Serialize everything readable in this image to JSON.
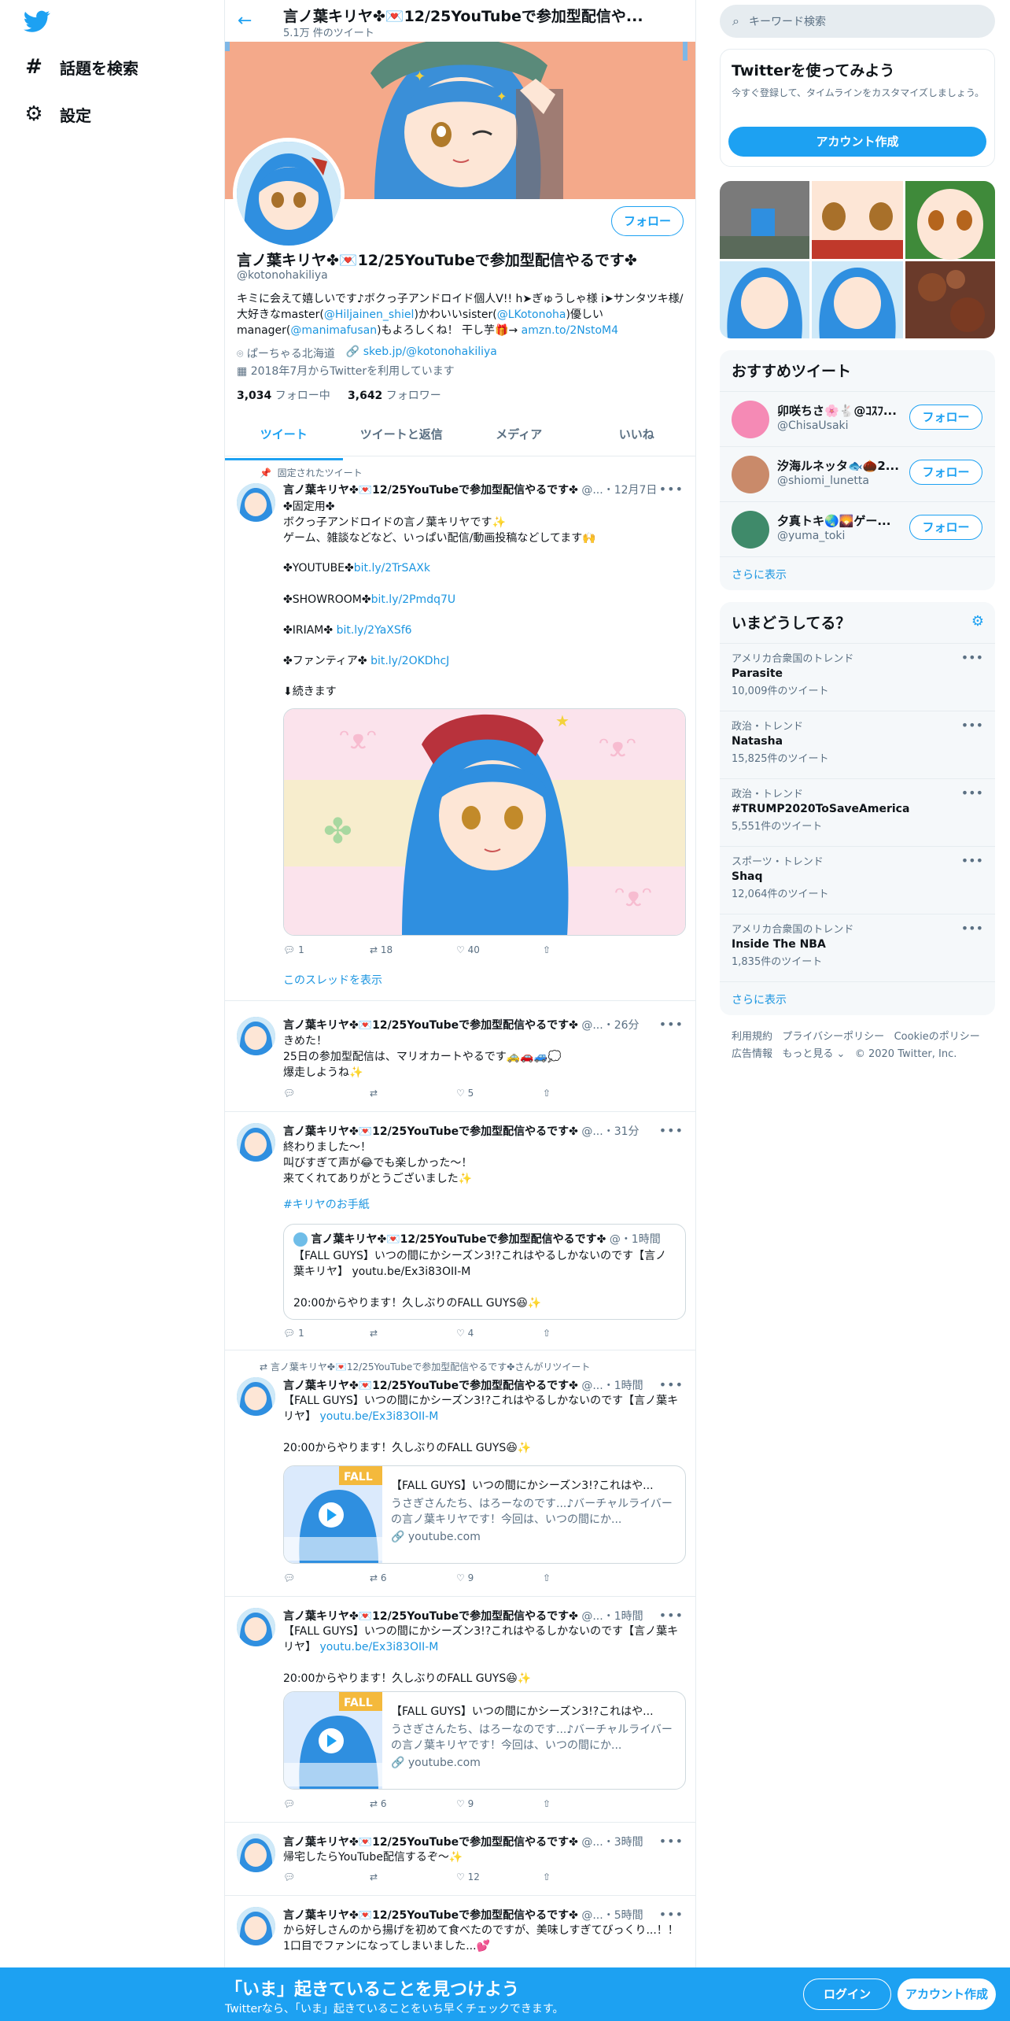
{
  "app": {
    "nav": [
      {
        "icon": "hash-icon",
        "label": "話題を検索"
      },
      {
        "icon": "gear-icon",
        "label": "設定"
      }
    ]
  },
  "header": {
    "title": "言ノ葉キリヤ✤💌12/25YouTubeで参加型配信や...",
    "subtitle": "5.1万 件のツイート"
  },
  "profile": {
    "follow": "フォロー",
    "name": "言ノ葉キリヤ✤💌12/25YouTubeで参加型配信やるです✤",
    "handle": "@kotonohakiliya",
    "bio_a": "キミに会えて嬉しいです♪ボクっ子アンドロイド個人V!! h➤ぎゅうしゃ様 i➤サンタツキ様/ 大好きなmaster(",
    "bio_link1": "@Hiljainen_shiel",
    "bio_b": ")かわいいsister(",
    "bio_link2": "@LKotonoha",
    "bio_c": ")優しいmanager(",
    "bio_link3": "@manimafusan",
    "bio_d": ")もよろしくね！ 干し芋🎁→ ",
    "bio_link4": "amzn.to/2NstoM4",
    "location": "ぱーちゃる北海道",
    "website": "skeb.jp/@kotonohakiliya",
    "joined": "2018年7月からTwitterを利用しています",
    "following_count": "3,034",
    "following_label": "フォロー中",
    "followers_count": "3,642",
    "followers_label": "フォロワー"
  },
  "tabs": [
    "ツイート",
    "ツイートと返信",
    "メディア",
    "いいね"
  ],
  "tweets": {
    "pinned": {
      "label": "固定されたツイート",
      "name": "言ノ葉キリヤ✤💌12/25YouTubeで参加型配信やるです✤",
      "meta": "@...・12月7日",
      "text": "✤固定用✤\nボクっ子アンドロイドの言ノ葉キリヤです✨\nゲーム、雑談などなど、いっぱい配信/動画投稿などしてます🙌",
      "l1a": "✤YOUTUBE✤",
      "l1b": "bit.ly/2TrSAXk",
      "l2a": "✤SHOWROOM✤",
      "l2b": "bit.ly/2Pmdq7U",
      "l3a": "✤IRIAM✤ ",
      "l3b": "bit.ly/2YaXSf6",
      "l4a": "✤ファンティア✤ ",
      "l4b": "bit.ly/2OKDhcJ",
      "cont": "⬇続きます",
      "reply": "1",
      "rt": "18",
      "like": "40",
      "thread": "このスレッドを表示"
    },
    "t2": {
      "name": "言ノ葉キリヤ✤💌12/25YouTubeで参加型配信やるです✤",
      "meta": "@...・26分",
      "text": "きめた！\n25日の参加型配信は、マリオカートやるです🚕🚗🚙💭\n爆走しようね✨",
      "reply": "",
      "rt": "",
      "like": "5"
    },
    "t3": {
      "name": "言ノ葉キリヤ✤💌12/25YouTubeで参加型配信やるです✤",
      "meta": "@...・31分",
      "text": "終わりました～！\n叫びすぎて声が😂でも楽しかった～！\n来てくれてありがとうございました✨",
      "tag": "#キリヤのお手紙",
      "qname": "言ノ葉キリヤ✤💌12/25YouTubeで参加型配信やるです✤",
      "qmeta": "@・1時間",
      "qtext": "【FALL GUYS】いつの間にかシーズン3!?これはやるしかないのです【言ノ葉キリヤ】 youtu.be/Ex3i83OII-M\n\n20:00からやります！久しぶりのFALL GUYS😆✨",
      "reply": "1",
      "rt": "",
      "like": "4"
    },
    "t4": {
      "ctx": "言ノ葉キリヤ✤💌12/25YouTubeで参加型配信やるです✤さんがリツイート",
      "name": "言ノ葉キリヤ✤💌12/25YouTubeで参加型配信やるです✤",
      "meta": "@...・1時間",
      "texta": "【FALL GUYS】いつの間にかシーズン3!?これはやるしかないのです【言ノ葉キリヤ】 ",
      "link": "youtu.be/Ex3i83OII-M",
      "textb": "\n\n20:00からやります！久しぶりのFALL GUYS😆✨",
      "ctitle": "【FALL GUYS】いつの間にかシーズン3!?これはや...",
      "cdesc": "うさぎさんたち、はろーなのです...♪バーチャルライバーの言ノ葉キリヤです！今回は、いつの間にか...",
      "cdomain": "youtube.com",
      "reply": "",
      "rt": "6",
      "like": "9"
    },
    "t5": {
      "name": "言ノ葉キリヤ✤💌12/25YouTubeで参加型配信やるです✤",
      "meta": "@...・1時間",
      "texta": "【FALL GUYS】いつの間にかシーズン3!?これはやるしかないのです【言ノ葉キリヤ】 ",
      "link": "youtu.be/Ex3i83OII-M",
      "textb": "\n\n20:00からやります！久しぶりのFALL GUYS😆✨",
      "ctitle": "【FALL GUYS】いつの間にかシーズン3!?これはや...",
      "cdesc": "うさぎさんたち、はろーなのです...♪バーチャルライバーの言ノ葉キリヤです！今回は、いつの間にか...",
      "cdomain": "youtube.com",
      "reply": "",
      "rt": "6",
      "like": "9"
    },
    "t6": {
      "name": "言ノ葉キリヤ✤💌12/25YouTubeで参加型配信やるです✤",
      "meta": "@...・3時間",
      "text": "帰宅したらYouTube配信するぞ～✨",
      "reply": "",
      "rt": "",
      "like": "12"
    },
    "t7": {
      "name": "言ノ葉キリヤ✤💌12/25YouTubeで参加型配信やるです✤",
      "meta": "@...・5時間",
      "text": "から好しさんのから揚げを初めて食べたのですが、美味しすぎてびっくり...！！\n1口目でファンになってしまいました...💕"
    }
  },
  "sidebar": {
    "search_placeholder": "キーワード検索",
    "signup": {
      "title": "Twitterを使ってみよう",
      "desc": "今すぐ登録して、タイムラインをカスタマイズしましょう。",
      "button": "アカウント作成"
    },
    "recommend": {
      "title": "おすすめツイート",
      "users": [
        {
          "name": "卯咲ちさ🌸🐇@ｺｽﾌ...",
          "handle": "@ChisaUsaki",
          "color": "#f58ab5"
        },
        {
          "name": "汐海ルネッタ🐟🌰2...",
          "handle": "@shiomi_lunetta",
          "color": "#c98a6a"
        },
        {
          "name": "夕真トキ🌏🌄ゲー...",
          "handle": "@yuma_toki",
          "color": "#3f8a6a"
        }
      ],
      "follow": "フォロー",
      "more": "さらに表示"
    },
    "trends": {
      "title": "いまどうしてる？",
      "items": [
        {
          "cat": "アメリカ合衆国のトレンド",
          "name": "Parasite",
          "count": "10,009件のツイート"
        },
        {
          "cat": "政治・トレンド",
          "name": "Natasha",
          "count": "15,825件のツイート"
        },
        {
          "cat": "政治・トレンド",
          "name": "#TRUMP2020ToSaveAmerica",
          "count": "5,551件のツイート"
        },
        {
          "cat": "スポーツ・トレンド",
          "name": "Shaq",
          "count": "12,064件のツイート"
        },
        {
          "cat": "アメリカ合衆国のトレンド",
          "name": "Inside The NBA",
          "count": "1,835件のツイート"
        }
      ],
      "more": "さらに表示"
    },
    "footer": {
      "links": [
        "利用規約",
        "プライバシーポリシー",
        "Cookieのポリシー",
        "広告情報",
        "もっと見る ⌄"
      ],
      "copy": "© 2020 Twitter, Inc."
    }
  },
  "bottombar": {
    "title": "「いま」起きていることを見つけよう",
    "sub": "Twitterなら、「いま」起きていることをいち早くチェックできます。",
    "login": "ログイン",
    "signup": "アカウント作成"
  }
}
